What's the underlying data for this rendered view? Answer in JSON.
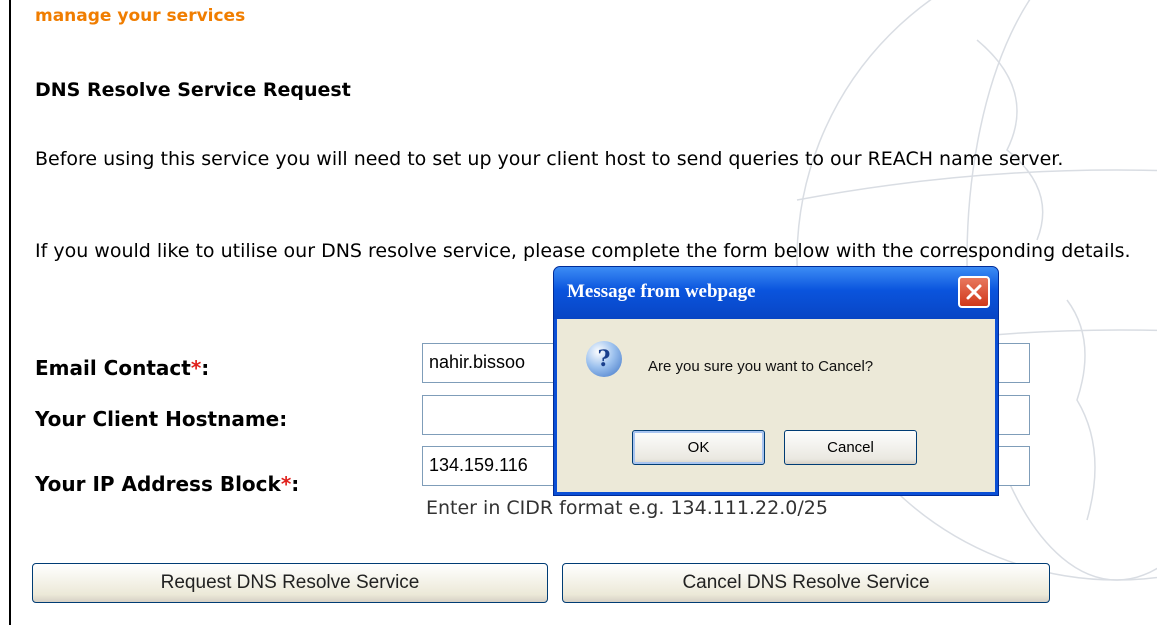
{
  "page": {
    "section_heading": "manage your services",
    "title": "DNS Resolve Service Request",
    "paragraph_1": "Before using this service you will need to set up your client host to send queries to our REACH name server.",
    "paragraph_2": "If you would like to utilise our DNS resolve service, please complete the form below with the corresponding details."
  },
  "form": {
    "email_label": "Email Contact",
    "email_value": "nahir.bissoo",
    "hostname_label": "Your Client Hostname:",
    "hostname_value": "",
    "ip_label": "Your IP Address Block",
    "ip_value": "134.159.116",
    "required_marker": "*",
    "label_colon": ":",
    "ip_hint": "Enter in CIDR format e.g. 134.111.22.0/25",
    "request_button": "Request DNS Resolve Service",
    "cancel_button": "Cancel DNS Resolve Service"
  },
  "dialog": {
    "title": "Message from webpage",
    "message": "Are you sure you want to Cancel?",
    "icon": "question-icon",
    "ok_label": "OK",
    "cancel_label": "Cancel"
  },
  "colors": {
    "heading_orange": "#f07d00",
    "required_red": "#e0201b",
    "dialog_title_blue": "#0a54dd"
  }
}
